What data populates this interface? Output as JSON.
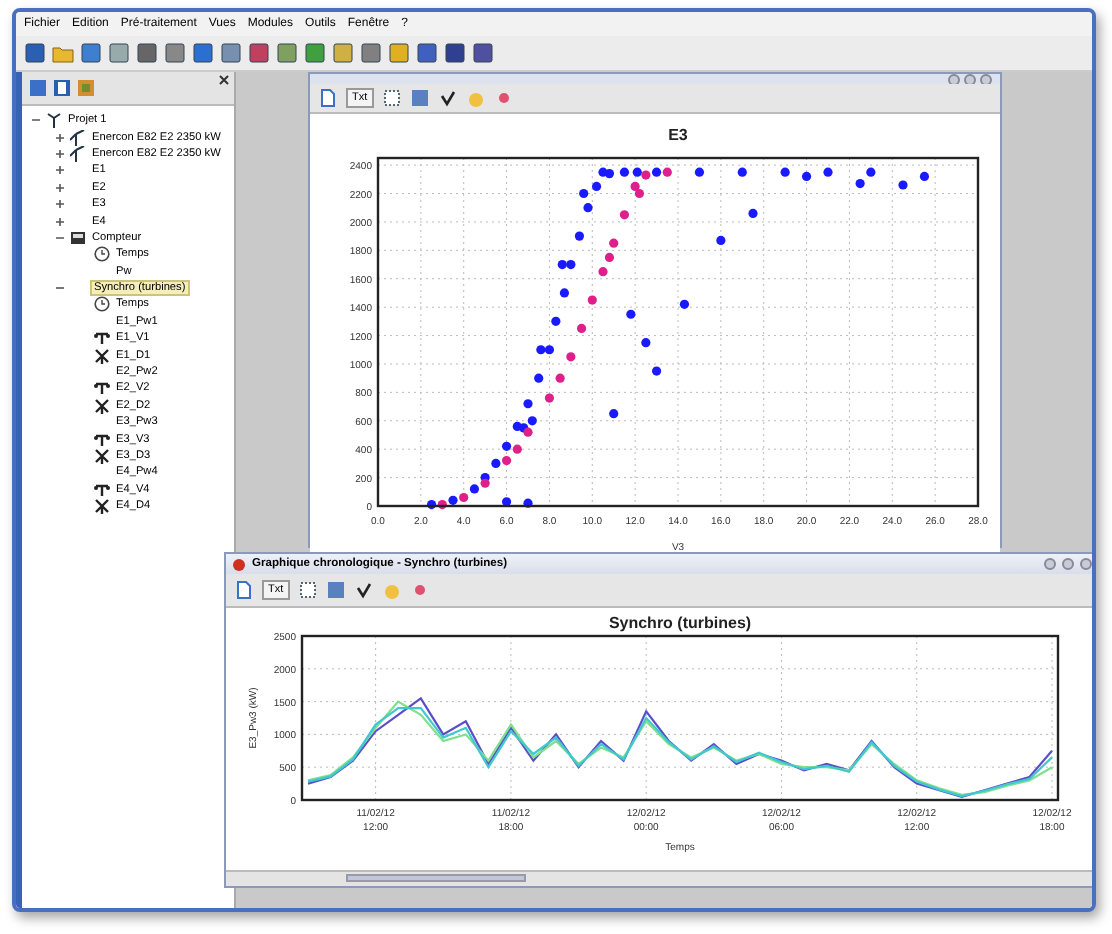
{
  "menu": [
    "Fichier",
    "Edition",
    "Pré-traitement",
    "Vues",
    "Modules",
    "Outils",
    "Fenêtre",
    "?"
  ],
  "tree": [
    {
      "label": "Projet 1",
      "kind": "project",
      "expanded": true,
      "selected": false,
      "children": [
        {
          "label": "Enercon E82 E2 2350 kW",
          "kind": "turbine",
          "expanded": false,
          "selected": false
        },
        {
          "label": "Enercon E82 E2 2350 kW",
          "kind": "turbine",
          "expanded": false,
          "selected": false
        },
        {
          "label": "E1",
          "kind": "plain",
          "expanded": false,
          "selected": false
        },
        {
          "label": "E2",
          "kind": "plain",
          "expanded": false,
          "selected": false
        },
        {
          "label": "E3",
          "kind": "plain",
          "expanded": false,
          "selected": false
        },
        {
          "label": "E4",
          "kind": "plain",
          "expanded": false,
          "selected": false
        },
        {
          "label": "Compteur",
          "kind": "meter",
          "expanded": true,
          "selected": false,
          "children": [
            {
              "label": "Temps",
              "kind": "clock",
              "selected": false
            },
            {
              "label": "Pw",
              "kind": "plain",
              "selected": false
            }
          ]
        },
        {
          "label": "Synchro (turbines)",
          "kind": "plain",
          "expanded": true,
          "selected": true,
          "children": [
            {
              "label": "Temps",
              "kind": "clock",
              "selected": false
            },
            {
              "label": "E1_Pw1",
              "kind": "plain",
              "selected": false
            },
            {
              "label": "E1_V1",
              "kind": "wind",
              "selected": false
            },
            {
              "label": "E1_D1",
              "kind": "direction",
              "selected": false
            },
            {
              "label": "E2_Pw2",
              "kind": "plain",
              "selected": false
            },
            {
              "label": "E2_V2",
              "kind": "wind",
              "selected": false
            },
            {
              "label": "E2_D2",
              "kind": "direction",
              "selected": false
            },
            {
              "label": "E3_Pw3",
              "kind": "plain",
              "selected": false
            },
            {
              "label": "E3_V3",
              "kind": "wind",
              "selected": false
            },
            {
              "label": "E3_D3",
              "kind": "direction",
              "selected": false
            },
            {
              "label": "E4_Pw4",
              "kind": "plain",
              "selected": false
            },
            {
              "label": "E4_V4",
              "kind": "wind",
              "selected": false
            },
            {
              "label": "E4_D4",
              "kind": "direction",
              "selected": false
            }
          ]
        }
      ]
    }
  ],
  "scatter_window": {
    "toolbar_text": "Txt",
    "chart_data": {
      "type": "scatter",
      "title": "E3",
      "xlabel": "V3",
      "grid": true,
      "ylim": [
        0,
        2450
      ],
      "yticks": [
        0,
        200,
        400,
        600,
        800,
        1000,
        1200,
        1400,
        1600,
        1800,
        2000,
        2200,
        2400
      ],
      "xlim": [
        0,
        28
      ],
      "xticks": [
        {
          "value": 0,
          "label": "0.0"
        },
        {
          "value": 2,
          "label": "2.0"
        },
        {
          "value": 4,
          "label": "4.0"
        },
        {
          "value": 6,
          "label": "6.0"
        },
        {
          "value": 8,
          "label": "8.0"
        },
        {
          "value": 10,
          "label": "10.0"
        },
        {
          "value": 12,
          "label": "12.0"
        },
        {
          "value": 14,
          "label": "14.0"
        },
        {
          "value": 16,
          "label": "16.0"
        },
        {
          "value": 18,
          "label": "18.0"
        },
        {
          "value": 20,
          "label": "20.0"
        },
        {
          "value": 22,
          "label": "22.0"
        },
        {
          "value": 24,
          "label": "24.0"
        },
        {
          "value": 26,
          "label": "26.0"
        },
        {
          "value": 28,
          "label": "28.0"
        }
      ],
      "series": [
        {
          "color": "#1a1aff",
          "x": [
            2.5,
            3.5,
            4.5,
            5,
            5.5,
            6,
            6.5,
            6.8,
            7,
            7.2,
            7.5,
            7.6,
            8,
            8.3,
            8.6,
            8.7,
            9,
            9.4,
            9.6,
            9.8,
            10.2,
            10.5,
            10.8,
            11.5,
            12.1,
            13,
            15,
            17,
            19,
            21,
            23,
            14.3,
            13,
            11.8,
            16,
            17.5,
            20,
            22.5,
            24.5,
            25.5,
            11,
            12.5,
            6,
            7
          ],
          "values": [
            10,
            40,
            120,
            200,
            300,
            420,
            560,
            550,
            720,
            600,
            900,
            1100,
            1100,
            1300,
            1700,
            1500,
            1700,
            1900,
            2200,
            2100,
            2250,
            2350,
            2340,
            2350,
            2350,
            2350,
            2350,
            2350,
            2350,
            2350,
            2350,
            1420,
            950,
            1350,
            1870,
            2060,
            2320,
            2270,
            2260,
            2320,
            650,
            1150,
            30,
            20
          ]
        },
        {
          "color": "#e0208a",
          "x": [
            3,
            4,
            5,
            6,
            6.5,
            7,
            8,
            8.5,
            9,
            9.5,
            10,
            10.5,
            10.8,
            11,
            11.5,
            12,
            12.2,
            12.5,
            13.5
          ],
          "values": [
            10,
            60,
            160,
            320,
            400,
            520,
            760,
            900,
            1050,
            1250,
            1450,
            1650,
            1750,
            1850,
            2050,
            2250,
            2200,
            2330,
            2350
          ]
        }
      ]
    }
  },
  "line_window": {
    "title": "Graphique chronologique - Synchro (turbines)",
    "toolbar_text": "Txt",
    "chart_data": {
      "type": "line",
      "title": "Synchro (turbines)",
      "xlabel": "Temps",
      "ylabel": "E3_Pw3 (kW)",
      "grid": true,
      "ylim": [
        0,
        2500
      ],
      "categories": [
        null,
        null,
        null,
        "11/02/12 12:00",
        null,
        null,
        null,
        null,
        null,
        "11/02/12 18:00",
        null,
        null,
        null,
        null,
        null,
        "12/02/12 00:00",
        null,
        null,
        null,
        null,
        null,
        "12/02/12 06:00",
        null,
        null,
        null,
        null,
        null,
        "12/02/12 12:00",
        null,
        null,
        null,
        null,
        null,
        "12/02/12 18:00"
      ],
      "yticks": [
        0,
        500,
        1000,
        1500,
        2000,
        2500
      ],
      "series": [
        {
          "color": "#5a4fc8",
          "values": [
            250,
            350,
            600,
            1050,
            1300,
            1550,
            1000,
            1200,
            550,
            1100,
            600,
            1000,
            500,
            900,
            600,
            1350,
            900,
            600,
            850,
            550,
            700,
            600,
            450,
            550,
            450,
            900,
            500,
            250,
            150,
            50,
            150,
            250,
            350,
            750
          ]
        },
        {
          "color": "#7ee08a",
          "values": [
            300,
            380,
            650,
            1100,
            1500,
            1300,
            900,
            1000,
            600,
            1150,
            650,
            900,
            550,
            800,
            650,
            1200,
            850,
            650,
            800,
            600,
            700,
            550,
            500,
            500,
            450,
            850,
            550,
            300,
            180,
            80,
            120,
            220,
            300,
            500
          ]
        },
        {
          "color": "#40c8d0",
          "values": [
            280,
            360,
            620,
            1150,
            1400,
            1400,
            950,
            1100,
            500,
            1050,
            700,
            950,
            520,
            850,
            620,
            1250,
            880,
            620,
            820,
            580,
            720,
            580,
            470,
            520,
            430,
            880,
            520,
            280,
            160,
            60,
            140,
            240,
            320,
            650
          ]
        }
      ]
    }
  }
}
